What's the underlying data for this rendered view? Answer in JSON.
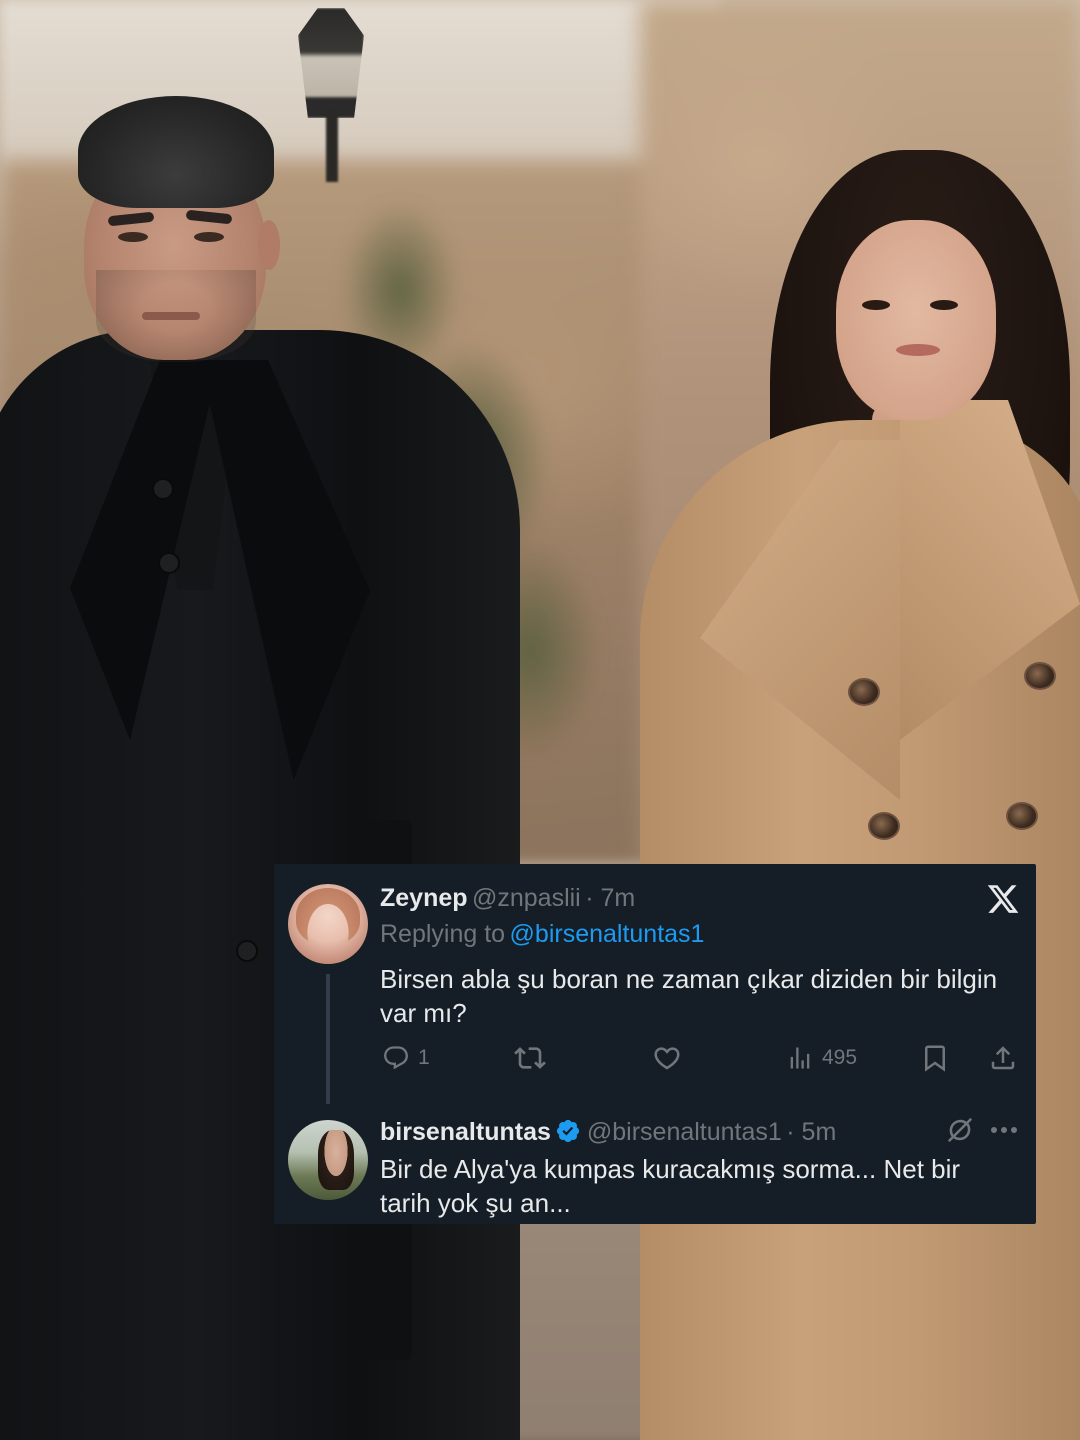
{
  "tweet": {
    "author": {
      "name": "Zeynep",
      "handle": "@znpaslii",
      "time": "· 7m"
    },
    "replying_label": "Replying to",
    "replying_handle": "@birsenaltuntas1",
    "text_lines": [
      "Birsen abla şu boran ne zaman çıkar diziden bir bilgin",
      "var mı?"
    ],
    "actions": {
      "reply_count": "1",
      "retweet_count": "",
      "like_count": "",
      "views_count": "495"
    }
  },
  "reply": {
    "author": {
      "name": "birsenaltuntas",
      "handle": "@birsenaltuntas1",
      "time": "· 5m",
      "verified": true
    },
    "text_lines": [
      "Bir de Alya'ya kumpas kuracakmış sorma... Net bir",
      "tarih yok şu an..."
    ]
  },
  "colors": {
    "card_background": "#151d26",
    "primary_text": "#e7e9ea",
    "muted_text": "#71767b",
    "link": "#1d9bf0",
    "verified_badge": "#1d9bf0"
  },
  "icons": {
    "brand": "x-logo-icon",
    "reply": "reply-icon",
    "retweet": "retweet-icon",
    "like": "heart-icon",
    "views": "views-icon",
    "bookmark": "bookmark-icon",
    "share": "share-icon",
    "grok": "grok-icon",
    "more": "more-icon"
  }
}
